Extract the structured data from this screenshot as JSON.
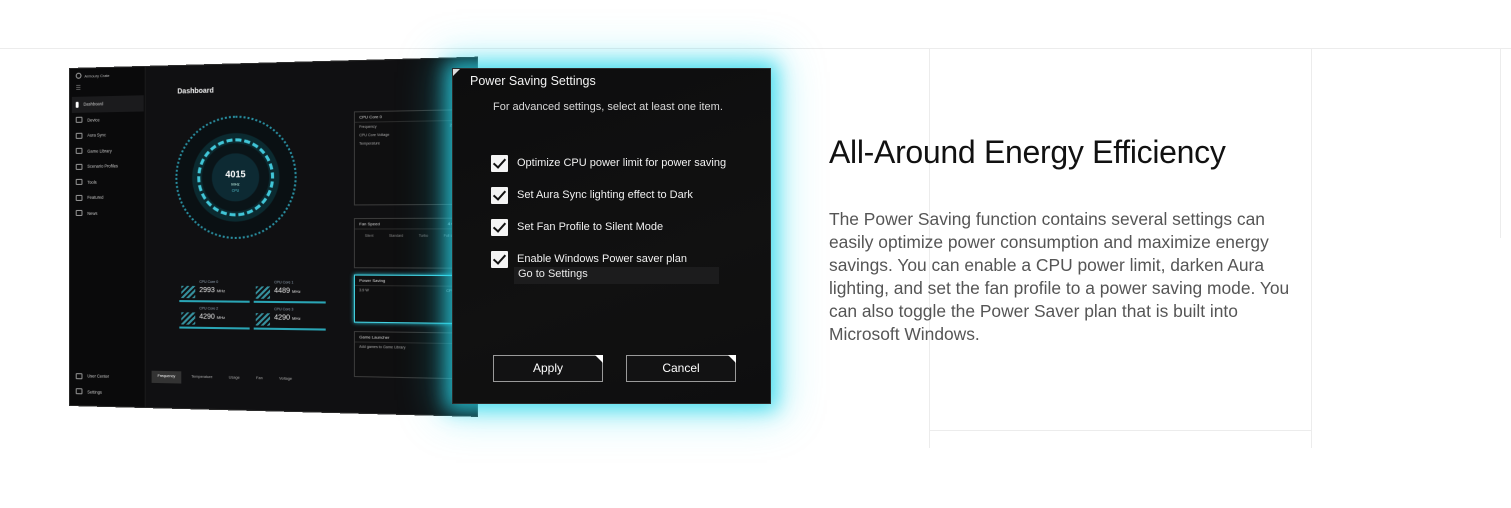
{
  "app": {
    "brand": "Armoury Crate",
    "menu_icon": "hamburger-icon",
    "title": "Dashboard",
    "nav": [
      {
        "label": "Dashboard",
        "icon": "info-icon"
      },
      {
        "label": "Device",
        "icon": "device-icon"
      },
      {
        "label": "Aura Sync",
        "icon": "aura-icon"
      },
      {
        "label": "Game Library",
        "icon": "library-icon"
      },
      {
        "label": "Scenario Profiles",
        "icon": "profiles-icon"
      },
      {
        "label": "Tools",
        "icon": "tools-icon"
      },
      {
        "label": "Featured",
        "icon": "tag-icon"
      },
      {
        "label": "News",
        "icon": "news-icon"
      }
    ],
    "nav_bottom": [
      {
        "label": "User Center",
        "icon": "user-icon"
      },
      {
        "label": "Settings",
        "icon": "gear-icon"
      }
    ],
    "gauge": {
      "value": "4015",
      "unit": "MHz",
      "label": "CPU"
    },
    "cores": [
      {
        "label": "CPU Core 0",
        "value": "2993",
        "unit": "MHz"
      },
      {
        "label": "CPU Core 1",
        "value": "4489",
        "unit": "MHz"
      },
      {
        "label": "CPU Core 2",
        "value": "4290",
        "unit": "MHz"
      },
      {
        "label": "CPU Core 3",
        "value": "4290",
        "unit": "MHz"
      }
    ],
    "tabs": [
      "Frequency",
      "Temperature",
      "Usage",
      "Fan",
      "Voltage"
    ],
    "cpu_panel": {
      "title": "CPU Core 0",
      "rows": [
        {
          "k": "Frequency",
          "v": "2993MHz"
        },
        {
          "k": "CPU Core Voltage",
          "v": "0.776V"
        },
        {
          "k": "Temperature",
          "v": "79°C"
        }
      ]
    },
    "fan_panel": {
      "title": "Fan Speed",
      "fans": "4 Cooling",
      "modes": [
        "Silent",
        "Standard",
        "Turbo",
        "Full speed"
      ]
    },
    "power_panel": {
      "title": "Power Saving",
      "value": "3.9 W",
      "sub": "CPU Power"
    },
    "game_panel": {
      "title": "Game Launcher",
      "text": "Add games to Game Library"
    }
  },
  "dialog": {
    "title": "Power Saving Settings",
    "subtitle": "For advanced settings, select at least one item.",
    "options": [
      "Optimize CPU power limit for power saving",
      "Set Aura Sync lighting effect to Dark",
      "Set Fan Profile to Silent Mode",
      "Enable Windows Power saver plan"
    ],
    "goto": "Go to Settings",
    "apply": "Apply",
    "cancel": "Cancel",
    "glow_color": "#28d7eb"
  },
  "copy": {
    "headline": "All-Around Energy Efficiency",
    "body": "The Power Saving function contains several settings can easily optimize power consumption and maximize energy savings. You can enable a CPU power limit, darken Aura lighting, and set the fan profile to a power saving mode. You can also toggle the Power Saver plan that is built into Microsoft Windows."
  }
}
